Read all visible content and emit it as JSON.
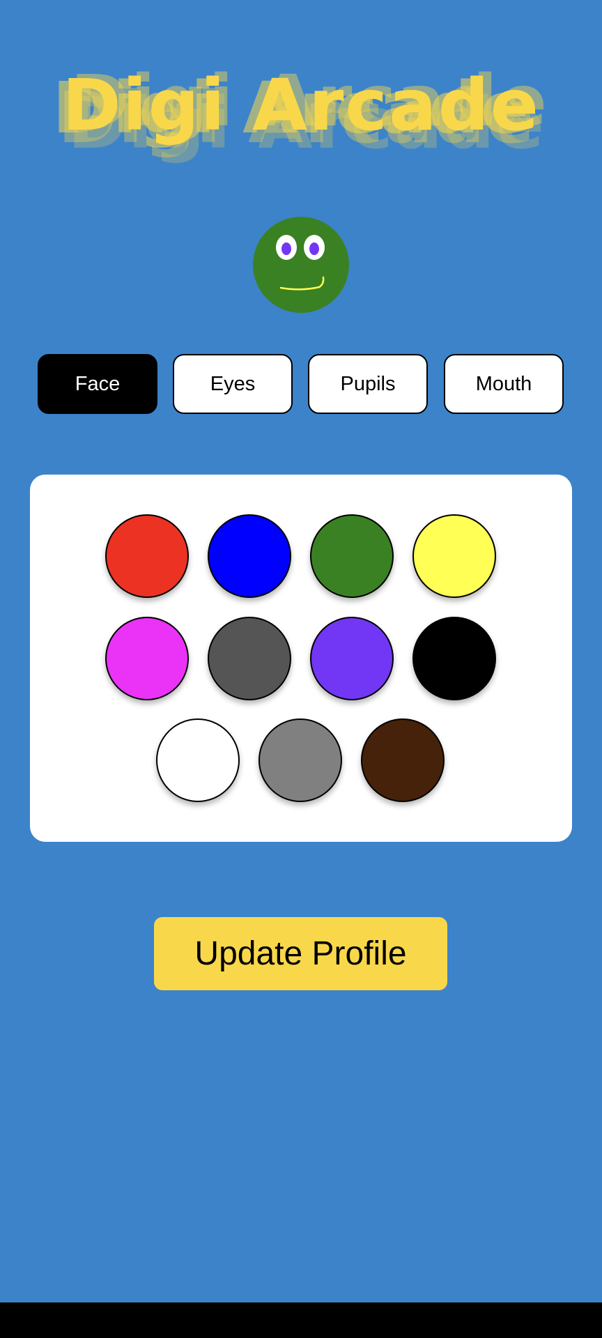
{
  "app": {
    "title": "Digi Arcade"
  },
  "avatar": {
    "face_color": "#3a8123",
    "eye_color": "#ffffff",
    "pupil_color": "#7236f5",
    "mouth_color": "#ffff55"
  },
  "tabs": [
    {
      "label": "Face",
      "active": true
    },
    {
      "label": "Eyes",
      "active": false
    },
    {
      "label": "Pupils",
      "active": false
    },
    {
      "label": "Mouth",
      "active": false
    }
  ],
  "palette": {
    "colors": [
      {
        "name": "red",
        "hex": "#ec3323"
      },
      {
        "name": "blue",
        "hex": "#0000ff"
      },
      {
        "name": "green",
        "hex": "#3a8123"
      },
      {
        "name": "yellow",
        "hex": "#ffff55"
      },
      {
        "name": "magenta",
        "hex": "#ea33f7"
      },
      {
        "name": "dark-gray",
        "hex": "#555555"
      },
      {
        "name": "purple",
        "hex": "#7236f5"
      },
      {
        "name": "black",
        "hex": "#000000"
      },
      {
        "name": "white",
        "hex": "#ffffff"
      },
      {
        "name": "gray",
        "hex": "#808080"
      },
      {
        "name": "brown",
        "hex": "#452209"
      }
    ]
  },
  "actions": {
    "update_label": "Update Profile"
  },
  "theme": {
    "background": "#3c83ca",
    "accent": "#f8d84a"
  }
}
